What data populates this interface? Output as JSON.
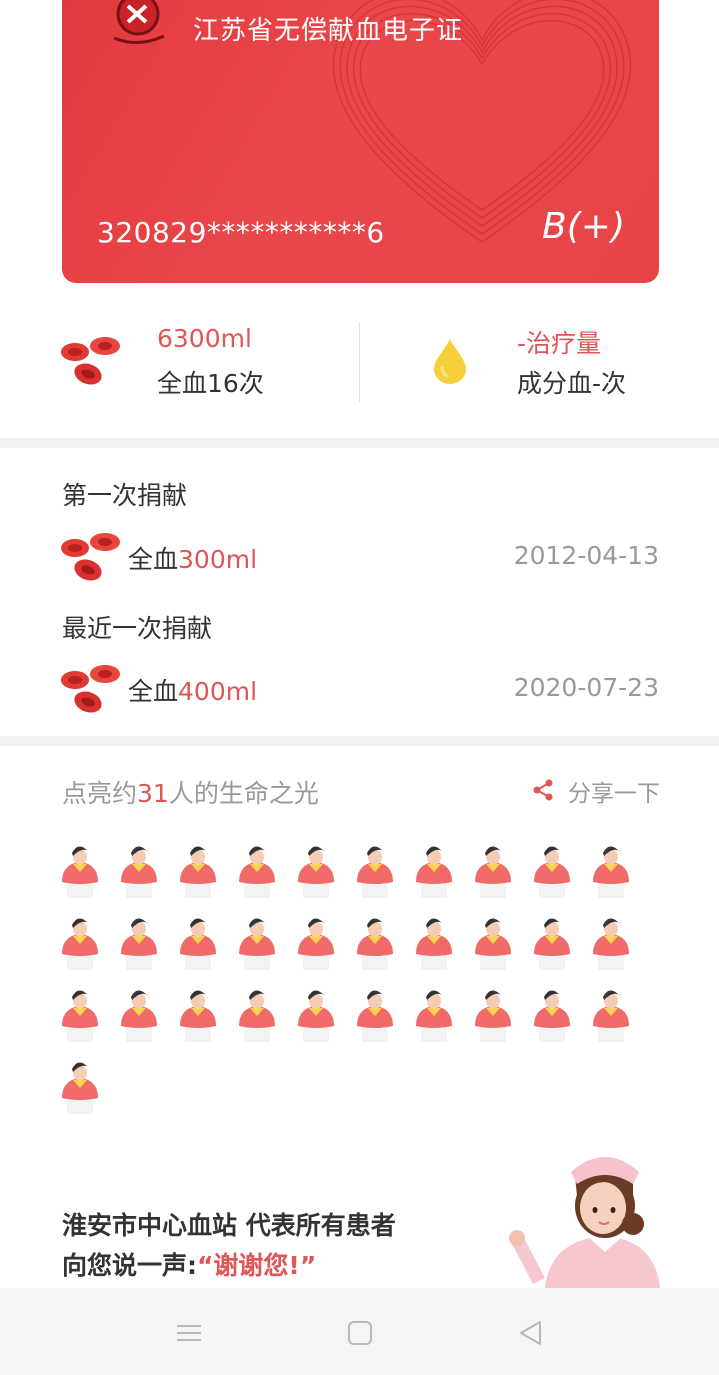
{
  "card": {
    "title": "江苏省无偿献血电子证",
    "id_number": "320829***********6",
    "blood_type": "B(+)"
  },
  "stats": {
    "whole_blood": {
      "value": "6300ml",
      "label": "全血16次",
      "icon": "red-blood-cells-icon"
    },
    "component": {
      "value": "-治疗量",
      "label": "成分血-次",
      "icon": "plasma-drop-icon"
    }
  },
  "donations": {
    "first_label": "第一次捐献",
    "first": {
      "type": "全血",
      "amount": "300ml",
      "date": "2012-04-13"
    },
    "latest_label": "最近一次捐献",
    "latest": {
      "type": "全血",
      "amount": "400ml",
      "date": "2020-07-23"
    }
  },
  "lives": {
    "prefix": "点亮约",
    "count": "31",
    "suffix": "人的生命之光",
    "share_label": "分享一下",
    "people_count": 31
  },
  "thanks": {
    "line1": "淮安市中心血站 代表所有患者",
    "line2_prefix": "向您说一声:",
    "line2_quote": "“谢谢您!”"
  },
  "colors": {
    "accent": "#e05555",
    "card": "#e5403f",
    "muted": "#999999"
  }
}
